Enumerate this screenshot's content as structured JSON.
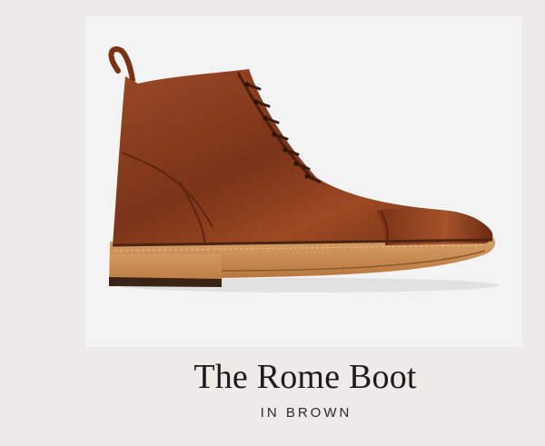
{
  "product": {
    "name": "The Rome Boot",
    "color_label": "IN BROWN",
    "image_icon": "boot-photo",
    "colors": {
      "page_background": "#ecebe8",
      "photo_background": "#f3f3f3",
      "leather": "#8b3d1f",
      "sole": "#c98a4e"
    }
  }
}
